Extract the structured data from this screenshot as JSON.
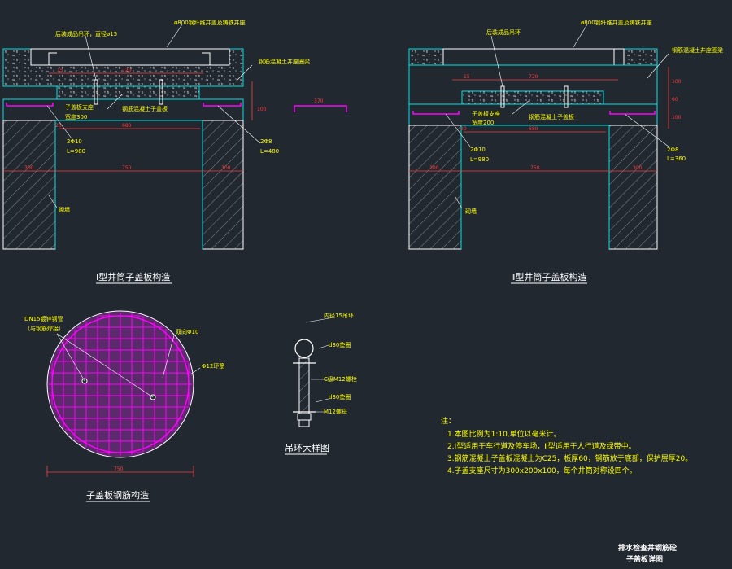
{
  "colors": {
    "background": "#212830",
    "outline": "#ffffff",
    "structure": "#00e5e5",
    "dimension": "#ff3b3b",
    "rebar": "#ff00ff",
    "label": "#ffff00",
    "hatch": "#9aa0a6"
  },
  "section1": {
    "title": "Ⅰ型井筒子盖板构造",
    "labels": {
      "top_cover": "ø800钢纤维井盖及铸铁井座",
      "lift_ring": "后装成品吊环，直径ø15",
      "ring_beam": "钢筋混凝土井座圈梁",
      "support": "子盖板支座",
      "width": "宽度300",
      "sub_cover": "钢筋混凝土子盖板",
      "rebar_left": "2Φ10",
      "rebar_left_len": "L=980",
      "rebar_right": "2Φ8",
      "rebar_right_len": "L=480",
      "brick": "砌墙"
    },
    "dims": {
      "d15": "15",
      "d720": "720",
      "d20": "20",
      "d680": "680",
      "d100": "100",
      "d300a": "300",
      "d750": "750",
      "d300b": "300",
      "inset": "370"
    }
  },
  "section2": {
    "title": "Ⅱ型井筒子盖板构造",
    "labels": {
      "top_cover": "ø800钢纤维井盖及铸铁井座",
      "lift_ring": "后装成品吊环",
      "ring_beam": "钢筋混凝土井座圈梁",
      "support": "子盖板支座",
      "width": "宽度200",
      "sub_cover": "钢筋混凝土子盖板",
      "rebar_left": "2Φ10",
      "rebar_left_len": "L=980",
      "rebar_right": "2Φ8",
      "rebar_right_len": "L=360",
      "brick": "砌墙"
    },
    "dims": {
      "d15": "15",
      "d720": "720",
      "d20": "20",
      "d680": "680",
      "d300a": "300",
      "d750": "750",
      "d300b": "300",
      "v100a": "100",
      "v60": "60",
      "v100b": "100"
    }
  },
  "plan": {
    "title": "子盖板钢筋构造",
    "pipe_label_1": "DN15镀锌钢管",
    "pipe_label_2": "（与钢筋焊接）",
    "mesh_label": "双向Φ10",
    "ring_label": "Φ12环筋",
    "diameter": "750"
  },
  "hook": {
    "title": "吊环大样图",
    "ring": "内径15吊环",
    "washer_top": "d30垫圈",
    "bolt": "C级M12螺栓",
    "washer_bottom": "d30垫圈",
    "nut": "M12螺母"
  },
  "notes": {
    "heading": "注：",
    "items": [
      "1.本图比例为1:10,单位以毫米计。",
      "2.Ⅰ型适用于车行道及停车场，Ⅱ型适用于人行道及绿带中。",
      "3.钢筋混凝土子盖板混凝土为C25，板厚60，钢筋放于底部，保护层厚20。",
      "4.子盖支座尺寸为300x200x100，每个井筒对称设四个。"
    ]
  },
  "title_block": {
    "line1": "排水检查井钢筋砼",
    "line2": "子盖板详图"
  }
}
